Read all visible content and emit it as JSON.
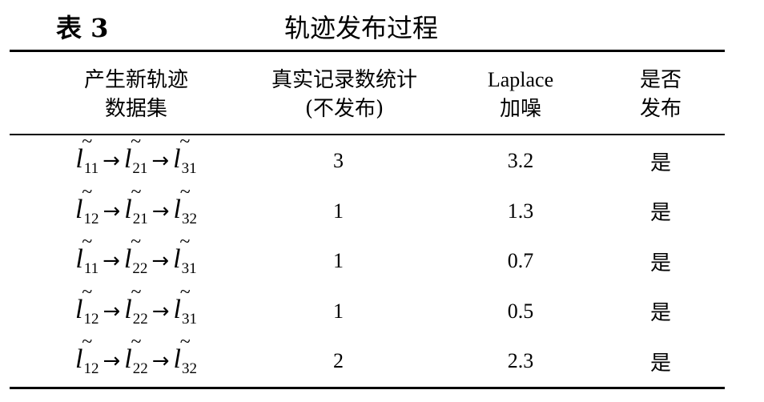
{
  "caption": {
    "label": "表 3",
    "title": "轨迹发布过程"
  },
  "headers": [
    {
      "lines": [
        "产生新轨迹",
        "数据集"
      ]
    },
    {
      "lines": [
        "真实记录数统计",
        "(不发布)"
      ]
    },
    {
      "lines": [
        "Laplace",
        "加噪"
      ]
    },
    {
      "lines": [
        "是否",
        "发布"
      ]
    }
  ],
  "symbol": {
    "letter": "l",
    "tilde": "~",
    "arrow": "→"
  },
  "rows": [
    {
      "trajectory": [
        "11",
        "21",
        "31"
      ],
      "count": "3",
      "laplace": "3.2",
      "publish": "是"
    },
    {
      "trajectory": [
        "12",
        "21",
        "32"
      ],
      "count": "1",
      "laplace": "1.3",
      "publish": "是"
    },
    {
      "trajectory": [
        "11",
        "22",
        "31"
      ],
      "count": "1",
      "laplace": "0.7",
      "publish": "是"
    },
    {
      "trajectory": [
        "12",
        "22",
        "31"
      ],
      "count": "1",
      "laplace": "0.5",
      "publish": "是"
    },
    {
      "trajectory": [
        "12",
        "22",
        "32"
      ],
      "count": "2",
      "laplace": "2.3",
      "publish": "是"
    }
  ]
}
